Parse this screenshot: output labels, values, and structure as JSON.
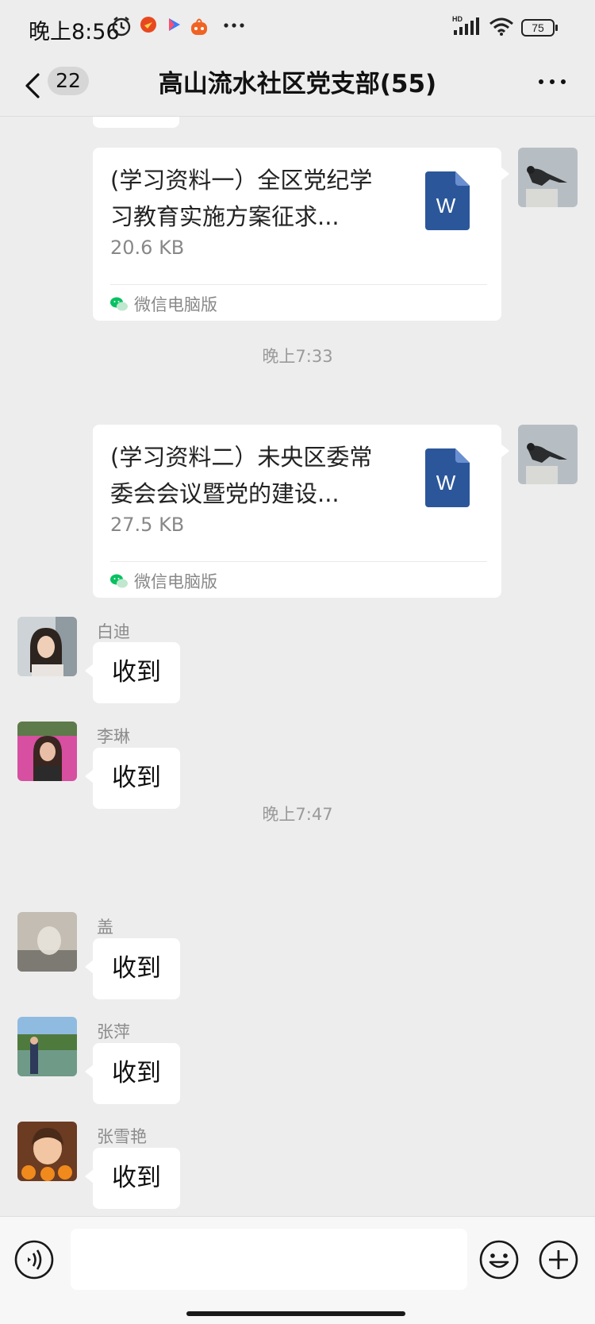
{
  "status_bar": {
    "time": "晚上8:56",
    "battery": "75",
    "network": "HD"
  },
  "nav": {
    "unread_count": "22",
    "title": "高山流水社区党支部(55)"
  },
  "chat": {
    "files": [
      {
        "name": "(学习资料一）全区党纪学习教育实施方案征求...",
        "size": "20.6 KB",
        "source": "微信电脑版"
      },
      {
        "name": "(学习资料二）未央区委常委会会议暨党的建设...",
        "size": "27.5 KB",
        "source": "微信电脑版"
      }
    ],
    "timestamps": [
      "晚上7:33",
      "晚上7:47"
    ],
    "messages": [
      {
        "sender": "白迪",
        "text": "收到"
      },
      {
        "sender": "李琳",
        "text": "收到"
      },
      {
        "sender": "盖",
        "text": "收到"
      },
      {
        "sender": "张萍",
        "text": "收到"
      },
      {
        "sender": "张雪艳",
        "text": "收到"
      }
    ]
  },
  "file_icon_letter": "W",
  "colors": {
    "background": "#ededed",
    "bubble": "#ffffff",
    "word_blue": "#2b579a",
    "wechat_green": "#07c160"
  }
}
